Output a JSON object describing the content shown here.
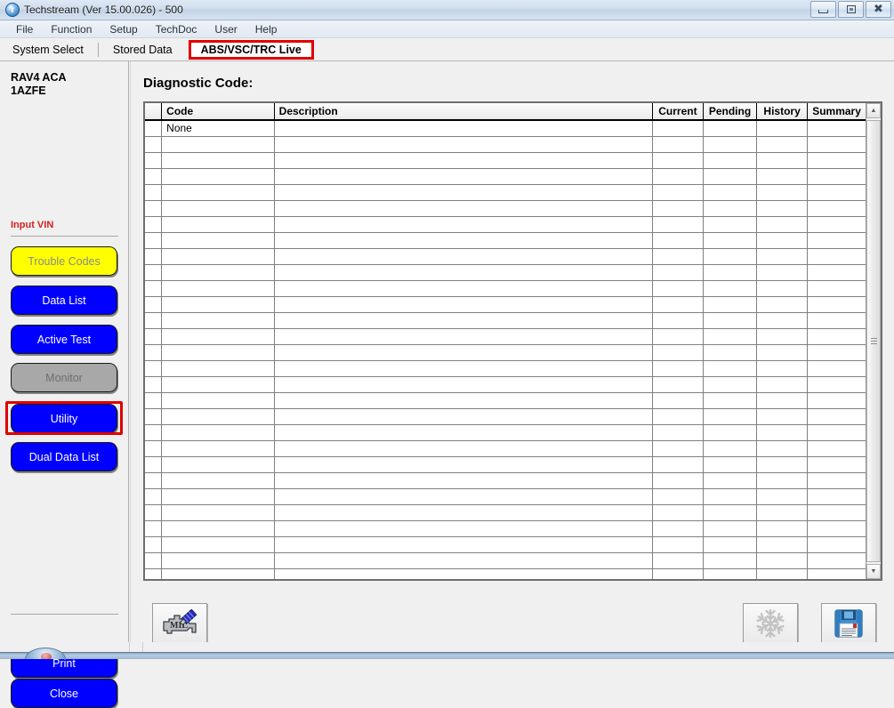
{
  "window": {
    "title": "Techstream (Ver 15.00.026) - 500",
    "icon": "techstream-logo-icon",
    "minimize_label": "Minimize",
    "maximize_label": "Maximize",
    "close_label": "Close"
  },
  "menubar": {
    "items": [
      {
        "label": "File"
      },
      {
        "label": "Function"
      },
      {
        "label": "Setup"
      },
      {
        "label": "TechDoc"
      },
      {
        "label": "User"
      },
      {
        "label": "Help"
      }
    ]
  },
  "tabs": [
    {
      "label": "System Select",
      "active": false
    },
    {
      "label": "Stored Data",
      "active": false
    },
    {
      "label": "ABS/VSC/TRC Live",
      "active": true
    }
  ],
  "sidebar": {
    "vehicle": "RAV4 ACA\n1AZFE",
    "input_vin_label": "Input VIN",
    "buttons": [
      {
        "label": "Trouble Codes",
        "style": "yellow"
      },
      {
        "label": "Data List",
        "style": "blue"
      },
      {
        "label": "Active Test",
        "style": "blue"
      },
      {
        "label": "Monitor",
        "style": "gray"
      },
      {
        "label": "Utility",
        "style": "blue",
        "highlighted": true
      },
      {
        "label": "Dual Data List",
        "style": "blue"
      }
    ],
    "footer_buttons": [
      {
        "label": "Print",
        "style": "blue"
      },
      {
        "label": "Close",
        "style": "blue"
      }
    ]
  },
  "main": {
    "title": "Diagnostic Code:",
    "table": {
      "columns": [
        "",
        "Code",
        "Description",
        "Current",
        "Pending",
        "History",
        "Summary"
      ],
      "rows": [
        [
          "",
          "None",
          "",
          "",
          "",
          "",
          ""
        ],
        [
          "",
          "",
          "",
          "",
          "",
          "",
          ""
        ],
        [
          "",
          "",
          "",
          "",
          "",
          "",
          ""
        ],
        [
          "",
          "",
          "",
          "",
          "",
          "",
          ""
        ],
        [
          "",
          "",
          "",
          "",
          "",
          "",
          ""
        ],
        [
          "",
          "",
          "",
          "",
          "",
          "",
          ""
        ],
        [
          "",
          "",
          "",
          "",
          "",
          "",
          ""
        ],
        [
          "",
          "",
          "",
          "",
          "",
          "",
          ""
        ],
        [
          "",
          "",
          "",
          "",
          "",
          "",
          ""
        ],
        [
          "",
          "",
          "",
          "",
          "",
          "",
          ""
        ],
        [
          "",
          "",
          "",
          "",
          "",
          "",
          ""
        ],
        [
          "",
          "",
          "",
          "",
          "",
          "",
          ""
        ],
        [
          "",
          "",
          "",
          "",
          "",
          "",
          ""
        ],
        [
          "",
          "",
          "",
          "",
          "",
          "",
          ""
        ],
        [
          "",
          "",
          "",
          "",
          "",
          "",
          ""
        ],
        [
          "",
          "",
          "",
          "",
          "",
          "",
          ""
        ],
        [
          "",
          "",
          "",
          "",
          "",
          "",
          ""
        ],
        [
          "",
          "",
          "",
          "",
          "",
          "",
          ""
        ],
        [
          "",
          "",
          "",
          "",
          "",
          "",
          ""
        ],
        [
          "",
          "",
          "",
          "",
          "",
          "",
          ""
        ],
        [
          "",
          "",
          "",
          "",
          "",
          "",
          ""
        ],
        [
          "",
          "",
          "",
          "",
          "",
          "",
          ""
        ],
        [
          "",
          "",
          "",
          "",
          "",
          "",
          ""
        ],
        [
          "",
          "",
          "",
          "",
          "",
          "",
          ""
        ],
        [
          "",
          "",
          "",
          "",
          "",
          "",
          ""
        ],
        [
          "",
          "",
          "",
          "",
          "",
          "",
          ""
        ],
        [
          "",
          "",
          "",
          "",
          "",
          "",
          ""
        ],
        [
          "",
          "",
          "",
          "",
          "",
          "",
          ""
        ],
        [
          "",
          "",
          "",
          "",
          "",
          "",
          ""
        ]
      ]
    },
    "scrollbar": {
      "up_arrow": "▲",
      "down_arrow": "▼"
    }
  },
  "toolbar": {
    "mil_button": {
      "icon": "engine-mil-wrench-icon",
      "label": "MIL"
    },
    "freeze_frame_button": {
      "icon": "snowflake-icon",
      "enabled": false
    },
    "save_button": {
      "icon": "floppy-disk-save-icon",
      "enabled": true
    }
  },
  "colors": {
    "button_blue": "#0000ff",
    "button_yellow": "#ffff00",
    "button_gray": "#a8a8a8",
    "highlight_red": "#e00000",
    "vin_red": "#d42020"
  }
}
